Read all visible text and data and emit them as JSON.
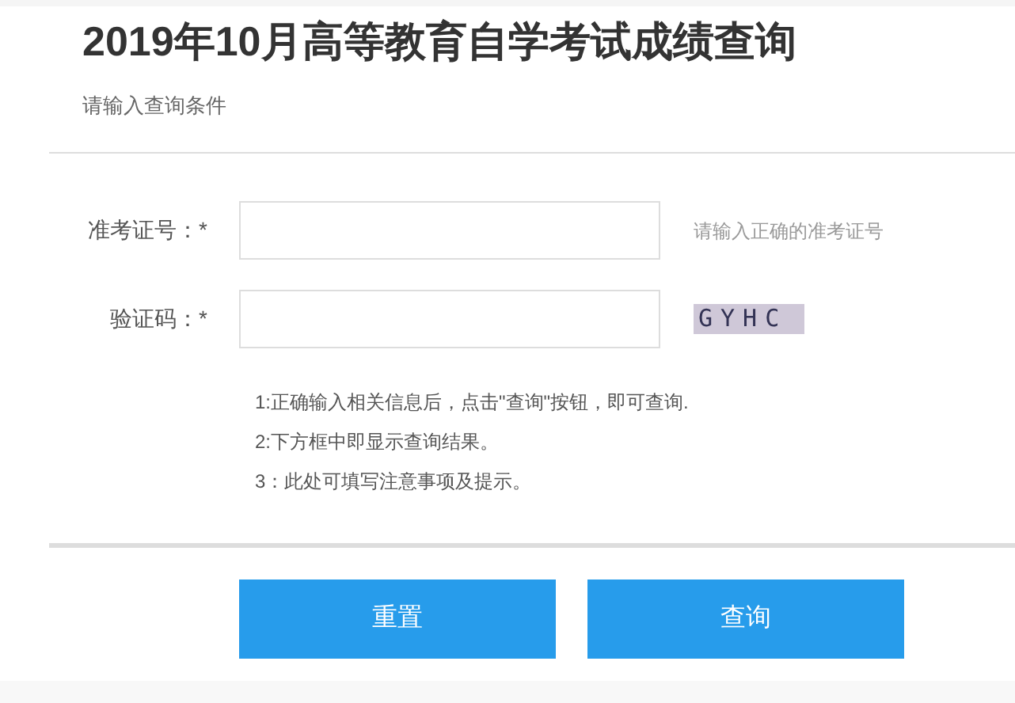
{
  "title": "2019年10月高等教育自学考试成绩查询",
  "subtitle": "请输入查询条件",
  "fields": [
    {
      "label": "准考证号：*",
      "kind": "hint",
      "hint": "请输入正确的准考证号"
    },
    {
      "label": "验证码：*",
      "kind": "captcha",
      "captcha": "GYHC"
    }
  ],
  "notes": [
    "1:正确输入相关信息后，点击\"查询\"按钮，即可查询.",
    "2:下方框中即显示查询结果。",
    "3：此处可填写注意事项及提示。"
  ],
  "buttons": [
    "重置",
    "查询"
  ]
}
